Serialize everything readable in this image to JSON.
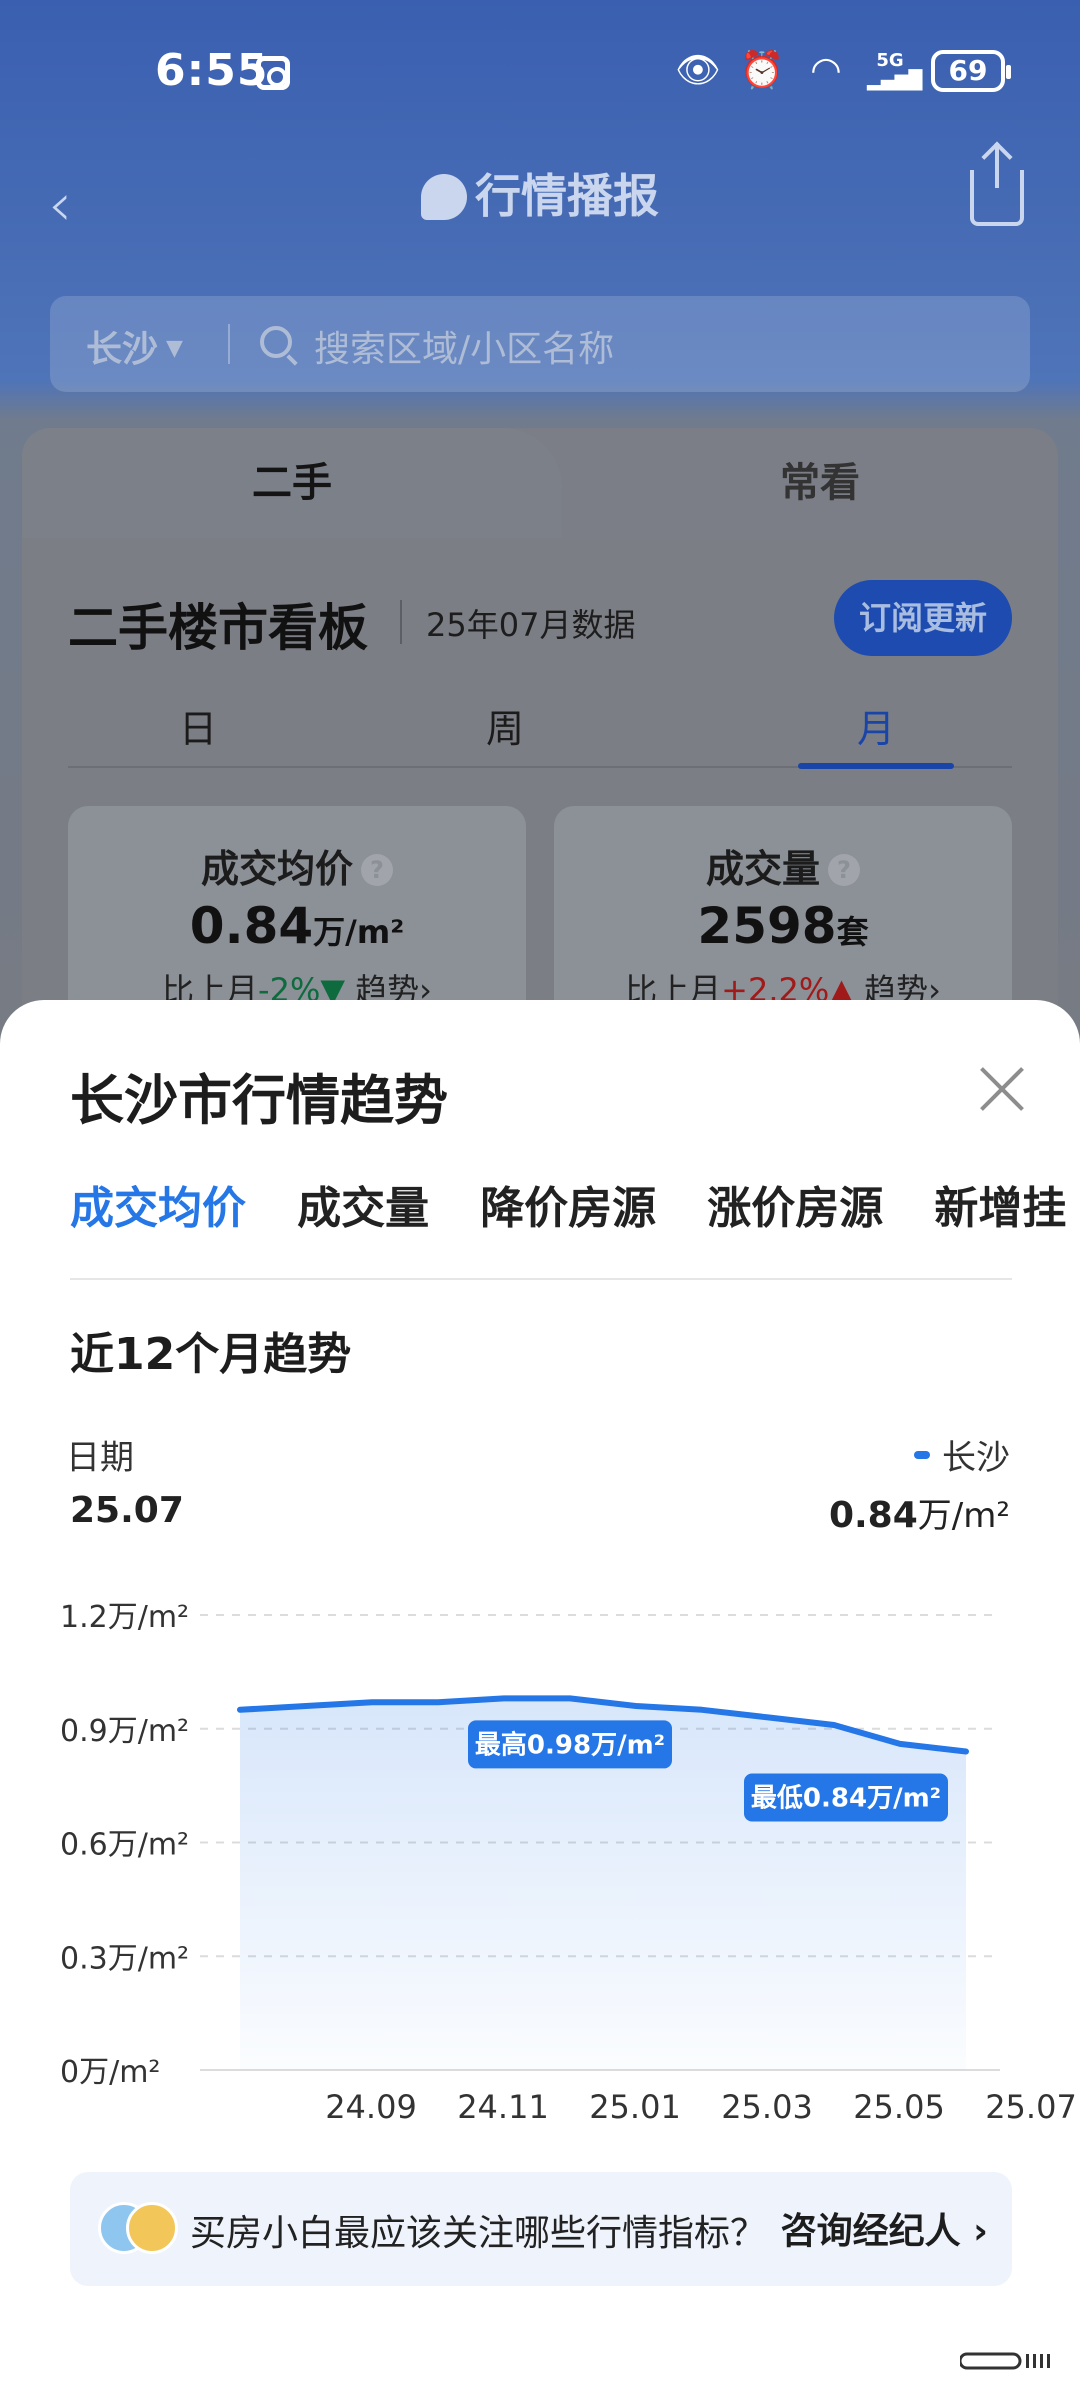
{
  "status_bar": {
    "time": "6:55",
    "network": "5G",
    "battery": "69",
    "icons": [
      "eye-comfort-icon",
      "alarm-icon",
      "wifi-icon",
      "signal-icon"
    ]
  },
  "nav": {
    "back_icon": "chevron-left-icon",
    "title": "行情播报",
    "share_icon": "share-icon"
  },
  "search": {
    "city": "长沙",
    "placeholder": "搜索区域/小区名称"
  },
  "board": {
    "tabs": [
      "二手",
      "常看"
    ],
    "active_tab": 0,
    "title": "二手楼市看板",
    "data_date": "25年07月数据",
    "subscribe_label": "订阅更新",
    "period_tabs": [
      "日",
      "周",
      "月"
    ],
    "active_period": 2,
    "stats": [
      {
        "label": "成交均价",
        "value": "0.84",
        "unit": "万/m²",
        "change_prefix": "比上月",
        "change": "-2%",
        "trend_label": "趋势"
      },
      {
        "label": "成交量",
        "value": "2598",
        "unit": "套",
        "change_prefix": "比上月",
        "change": "+2.2%",
        "trend_label": "趋势"
      }
    ]
  },
  "sheet": {
    "title": "长沙市行情趋势",
    "metric_tabs": [
      "成交均价",
      "成交量",
      "降价房源",
      "涨价房源",
      "新增挂"
    ],
    "active_metric": 0,
    "trend_title": "近12个月趋势",
    "date_label": "日期",
    "date_value": "25.07",
    "legend_name": "长沙",
    "legend_value": "0.84",
    "legend_unit": "万/m²",
    "promo_text": "买房小白最应该关注哪些行情指标？",
    "promo_link": "咨询经纪人"
  },
  "chart_data": {
    "type": "area",
    "x": [
      "24.08",
      "24.09",
      "24.10",
      "24.11",
      "24.12",
      "25.01",
      "25.02",
      "25.03",
      "25.04",
      "25.05",
      "25.06",
      "25.07"
    ],
    "x_tick_labels": [
      "24.09",
      "24.11",
      "25.01",
      "25.03",
      "25.05",
      "25.07"
    ],
    "series": [
      {
        "name": "长沙",
        "values": [
          0.95,
          0.96,
          0.97,
          0.97,
          0.98,
          0.98,
          0.96,
          0.95,
          0.93,
          0.91,
          0.86,
          0.84
        ],
        "color": "#2576e6"
      }
    ],
    "y_tick_labels": [
      "1.2万/m²",
      "0.9万/m²",
      "0.6万/m²",
      "0.3万/m²",
      "0万/m²"
    ],
    "ylim": [
      0,
      1.2
    ],
    "grid": true,
    "annotations": [
      {
        "text": "最高0.98万/m²",
        "index": 5
      },
      {
        "text": "最低0.84万/m²",
        "index": 11
      }
    ]
  }
}
